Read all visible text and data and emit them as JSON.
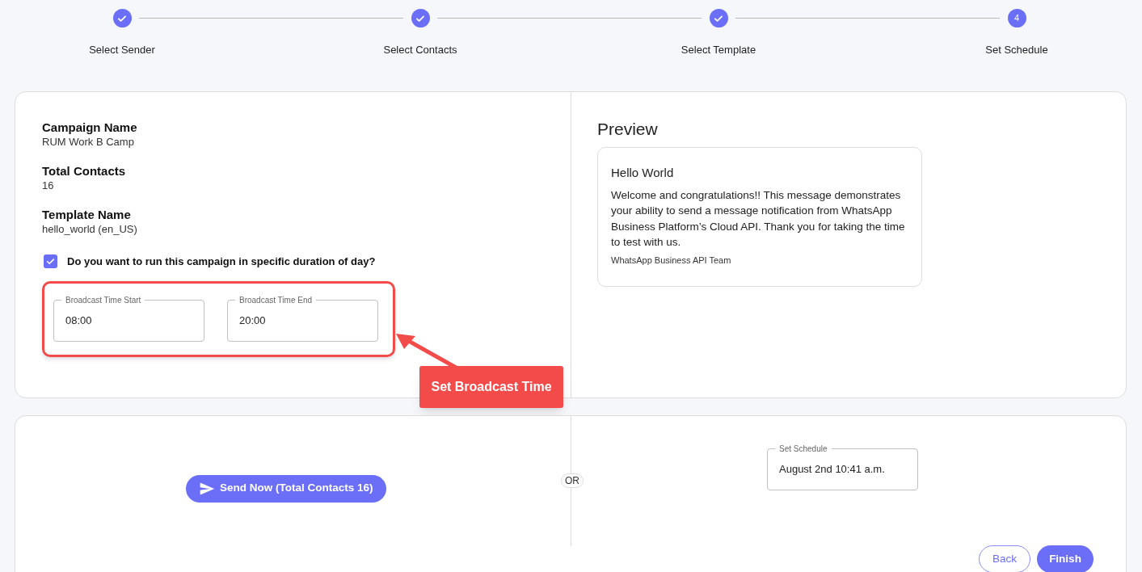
{
  "steps": [
    {
      "label": "Select Sender",
      "done": true
    },
    {
      "label": "Select Contacts",
      "done": true
    },
    {
      "label": "Select Template",
      "done": true
    },
    {
      "label": "Set Schedule",
      "done": false,
      "number": "4"
    }
  ],
  "summary": [
    {
      "label": "Campaign Name",
      "value": "RUM Work B Camp"
    },
    {
      "label": "Total Contacts",
      "value": "16"
    },
    {
      "label": "Template Name",
      "value": "hello_world (en_US)"
    }
  ],
  "duration_option": {
    "label": "Do you want to run this campaign in specific duration of day?",
    "checked": true
  },
  "time_fields": [
    {
      "label": "Broadcast Time Start",
      "value": "08:00"
    },
    {
      "label": "Broadcast Time End",
      "value": "20:00"
    }
  ],
  "callout": "Set Broadcast Time",
  "preview": {
    "title": "Preview",
    "header": "Hello World",
    "body": "Welcome and congratulations!! This message demonstrates your ability to send a message notification from WhatsApp Business Platform’s Cloud API. Thank you for taking the time to test with us.",
    "footer": "WhatsApp Business API Team"
  },
  "send_now": "Send Now (Total Contacts 16)",
  "or_label": "OR",
  "schedule": {
    "label": "Set Schedule",
    "value": "August 2nd 10:41 a.m."
  },
  "buttons": {
    "back": "Back",
    "finish": "Finish"
  }
}
